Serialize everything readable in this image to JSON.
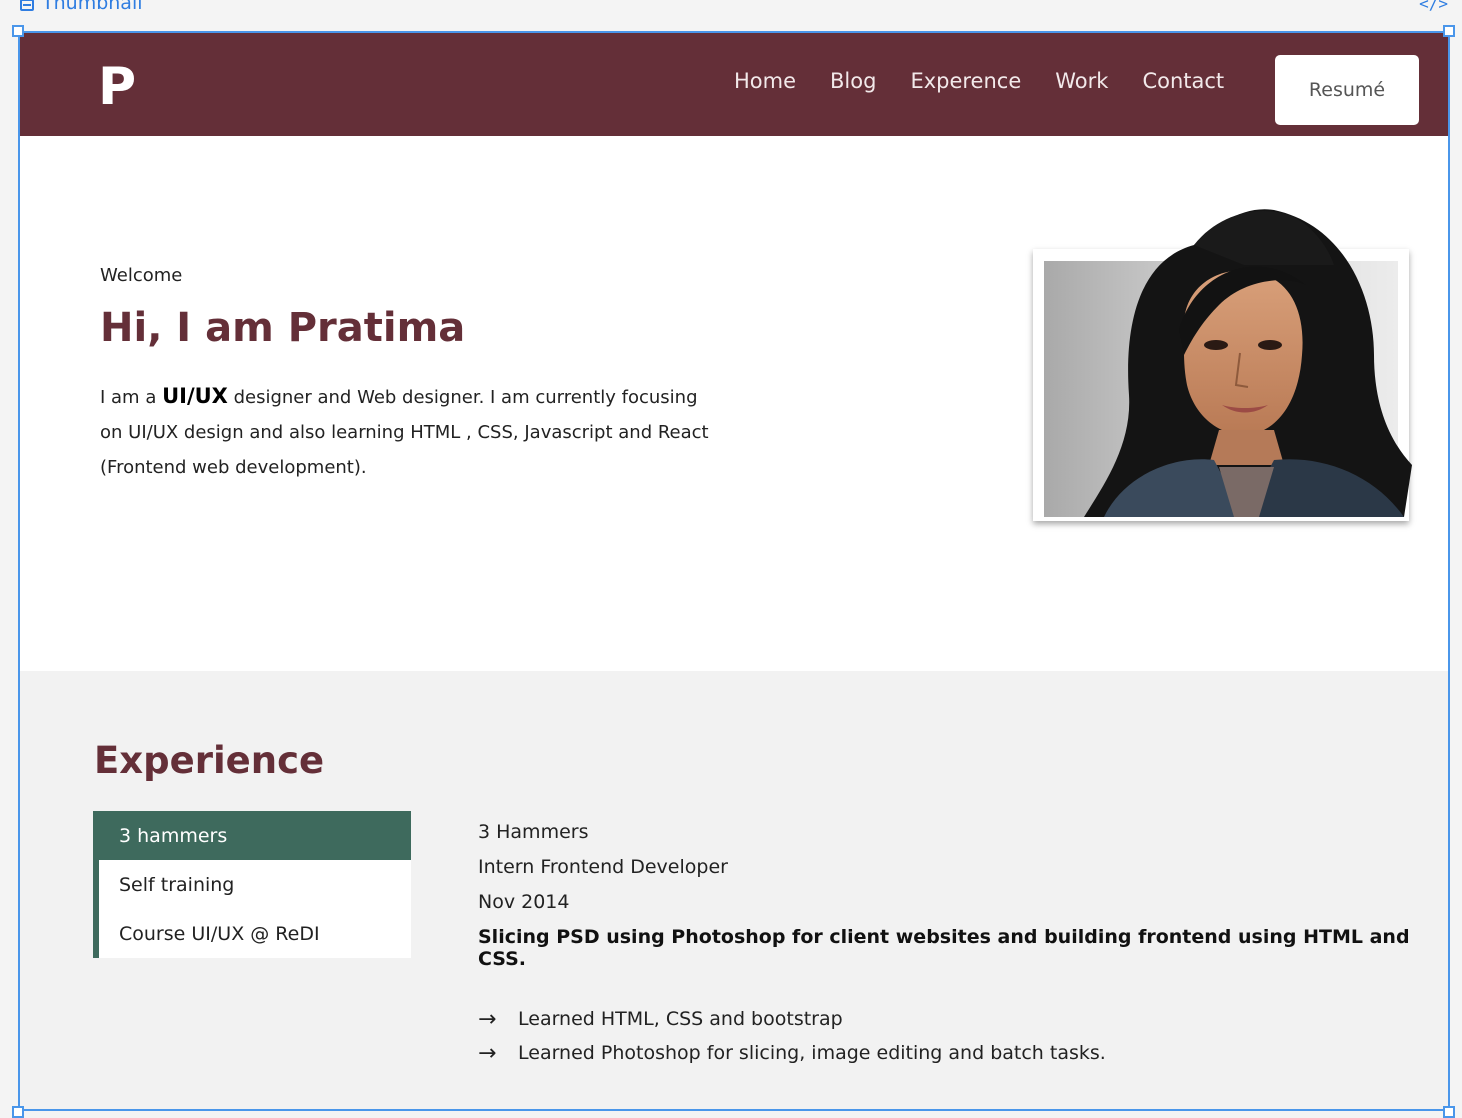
{
  "editor": {
    "frame_label": "Thumbnail",
    "code_icon": "code-icon"
  },
  "nav": {
    "logo": "P",
    "links": [
      "Home",
      "Blog",
      "Experence",
      "Work",
      "Contact"
    ],
    "resume_label": "Resumé"
  },
  "hero": {
    "welcome": "Welcome",
    "title": "Hi, I am Pratima",
    "intro_pre": "I am a ",
    "intro_bold": "UI/UX",
    "intro_post": " designer and Web designer. I am currently focusing on UI/UX design and also learning HTML , CSS,  Javascript and React (Frontend web development)."
  },
  "experience": {
    "title": "Experience",
    "tabs": [
      "3 hammers",
      "Self training",
      "Course UI/UX @ ReDI"
    ],
    "active_tab": 0,
    "detail": {
      "company": "3 Hammers",
      "role": "Intern Frontend Developer",
      "date": "Nov 2014",
      "summary": "Slicing PSD using Photoshop for client websites and building frontend using HTML and CSS.",
      "bullets": [
        "Learned HTML, CSS and bootstrap",
        "Learned Photoshop for slicing, image editing and batch tasks."
      ]
    }
  },
  "colors": {
    "brand": "#642f38",
    "accent": "#3e6a5d",
    "selection": "#4a96ea"
  }
}
